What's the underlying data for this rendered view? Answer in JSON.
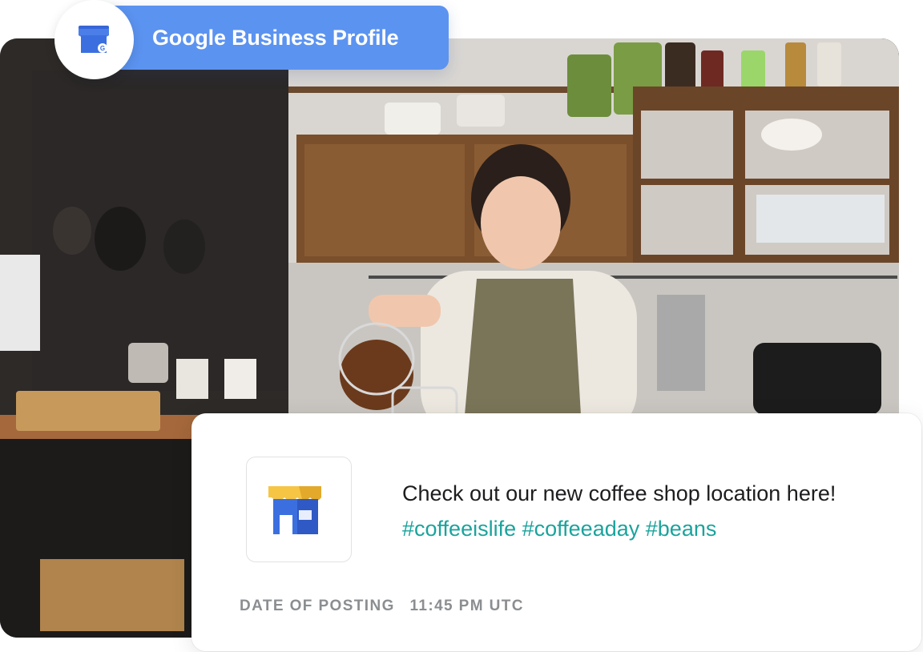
{
  "badge": {
    "label": "Google Business Profile",
    "icon": "storefront-icon"
  },
  "post": {
    "text": "Check out our new coffee shop location here!",
    "hashtags": [
      "#coffeeislife",
      "#coffeeaday",
      "#beans"
    ],
    "thumbnail_icon": "storefront-icon"
  },
  "meta": {
    "date_label": "DATE OF POSTING",
    "time": "11:45 PM UTC"
  },
  "colors": {
    "badge_blue": "#5b93f0",
    "hashtag_teal": "#1ba39c",
    "awning_yellow": "#f6c544",
    "store_blue": "#3b6fe0"
  }
}
